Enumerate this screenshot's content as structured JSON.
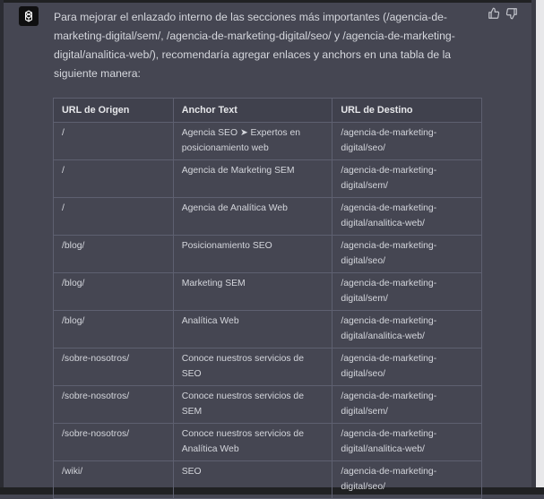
{
  "message": {
    "text": "Para mejorar el enlazado interno de las secciones más importantes (/agencia-de-marketing-digital/sem/, /agencia-de-marketing-digital/seo/ y /agencia-de-marketing-digital/analitica-web/), recomendaría agregar enlaces y anchors en una tabla de la siguiente manera:"
  },
  "table": {
    "headers": [
      "URL de Origen",
      "Anchor Text",
      "URL de Destino"
    ],
    "rows": [
      [
        "/",
        "Agencia SEO ➤ Expertos en posicionamiento web",
        "/agencia-de-marketing-digital/seo/"
      ],
      [
        "/",
        "Agencia de Marketing SEM",
        "/agencia-de-marketing-digital/sem/"
      ],
      [
        "/",
        "Agencia de Analítica Web",
        "/agencia-de-marketing-digital/analitica-web/"
      ],
      [
        "/blog/",
        "Posicionamiento SEO",
        "/agencia-de-marketing-digital/seo/"
      ],
      [
        "/blog/",
        "Marketing SEM",
        "/agencia-de-marketing-digital/sem/"
      ],
      [
        "/blog/",
        "Analítica Web",
        "/agencia-de-marketing-digital/analitica-web/"
      ],
      [
        "/sobre-nosotros/",
        "Conoce nuestros servicios de SEO",
        "/agencia-de-marketing-digital/seo/"
      ],
      [
        "/sobre-nosotros/",
        "Conoce nuestros servicios de SEM",
        "/agencia-de-marketing-digital/sem/"
      ],
      [
        "/sobre-nosotros/",
        "Conoce nuestros servicios de Analítica Web",
        "/agencia-de-marketing-digital/analitica-web/"
      ],
      [
        "/wiki/",
        "SEO",
        "/agencia-de-marketing-digital/seo/"
      ]
    ]
  },
  "icons": {
    "avatar": "openai-logo-icon",
    "thumbs_up": "thumbs-up-icon",
    "thumbs_down": "thumbs-down-icon"
  },
  "colors": {
    "background": "#454652",
    "avatar_bg": "#0f0f10",
    "text": "#d5d7dd",
    "table_header_bg": "#40414d",
    "table_border": "#5e6070"
  }
}
